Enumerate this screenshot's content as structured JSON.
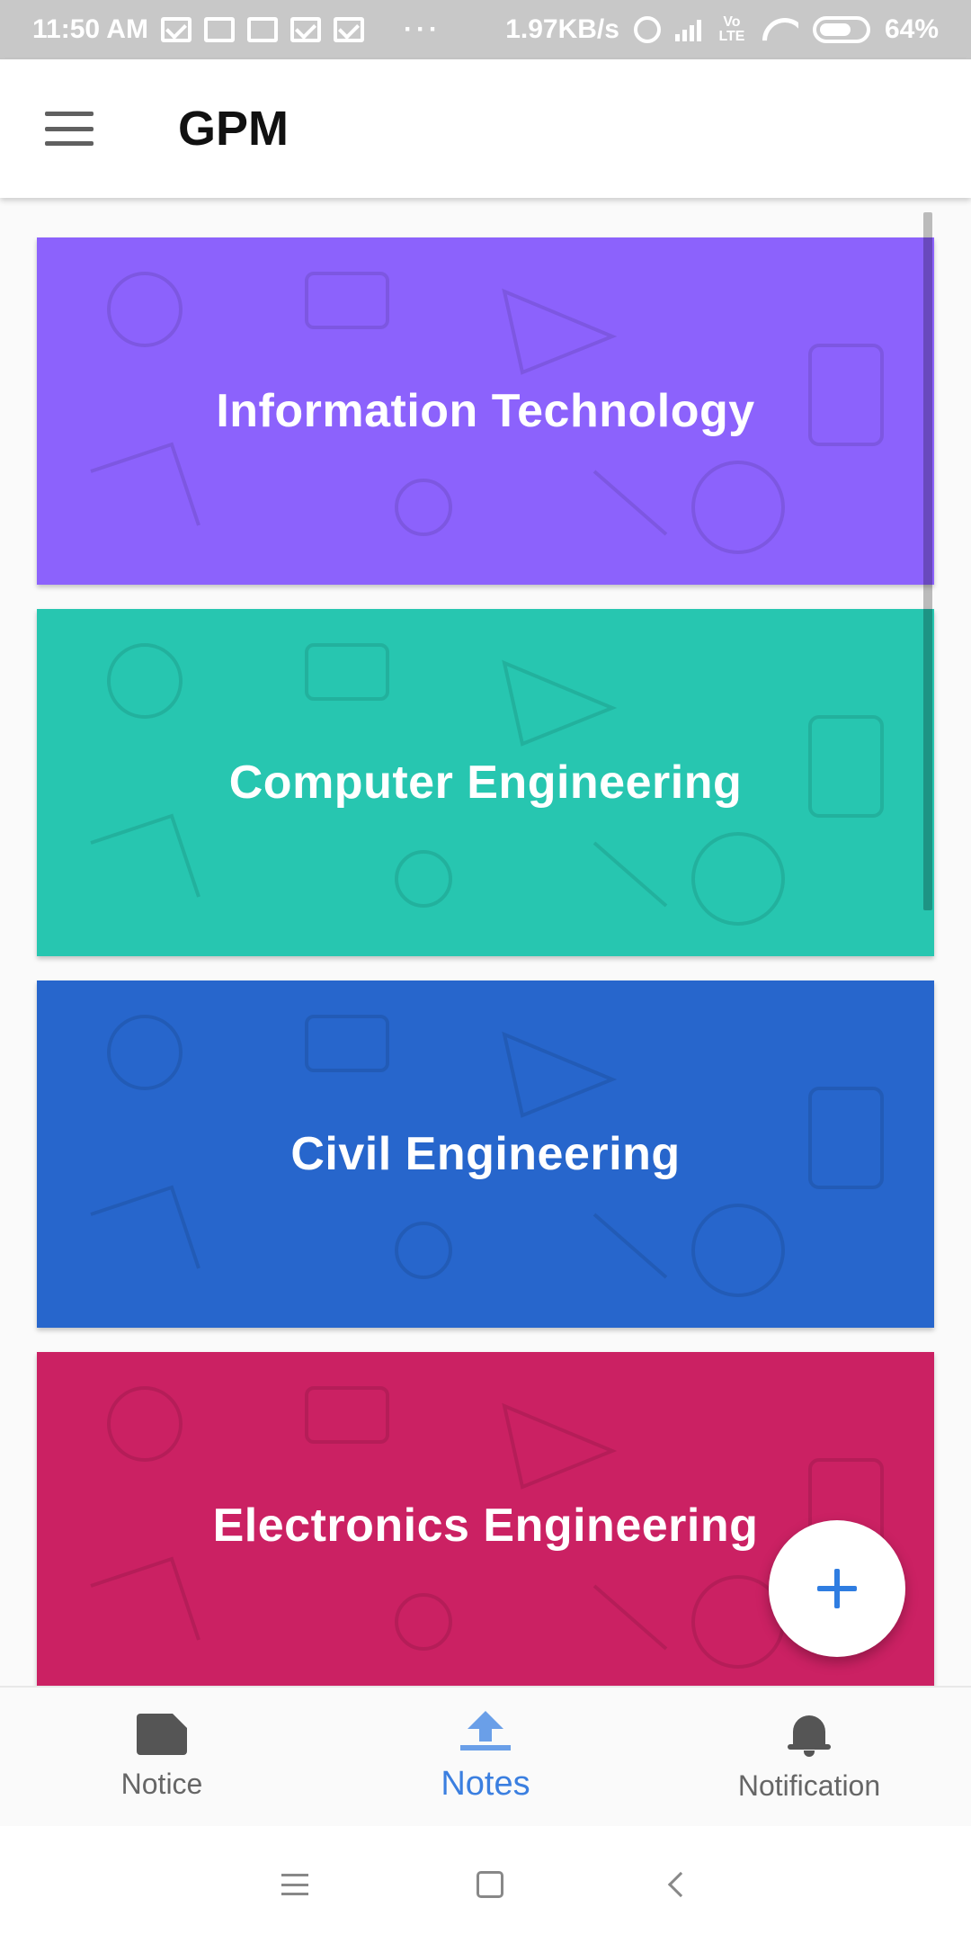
{
  "status_bar": {
    "time": "11:50 AM",
    "dots": "···",
    "network_speed": "1.97KB/s",
    "network_type": "Vo LTE",
    "battery": "64%",
    "icons": [
      "mail-icon",
      "book-icon",
      "clapper-icon",
      "mail-icon",
      "mail-icon",
      "alarm-icon",
      "signal-icon",
      "wifi-icon",
      "battery-icon"
    ]
  },
  "app_bar": {
    "title": "GPM",
    "menu_icon": "hamburger-menu-icon"
  },
  "cards": [
    {
      "label": "Information Technology",
      "color": "#8c62fc"
    },
    {
      "label": "Computer Engineering",
      "color": "#27c6b0"
    },
    {
      "label": "Civil Engineering",
      "color": "#2766cc"
    },
    {
      "label": "Electronics Engineering",
      "color": "#cb2163"
    }
  ],
  "fab": {
    "icon": "plus-icon",
    "color": "#2f7de1"
  },
  "bottom_nav": {
    "items": [
      {
        "label": "Notice",
        "icon": "notice-icon",
        "active": false
      },
      {
        "label": "Notes",
        "icon": "upload-icon",
        "active": true
      },
      {
        "label": "Notification",
        "icon": "bell-icon",
        "active": false
      }
    ],
    "active_color": "#3b7fe0"
  },
  "system_nav": {
    "icons": [
      "recents-icon",
      "home-icon",
      "back-icon"
    ]
  }
}
